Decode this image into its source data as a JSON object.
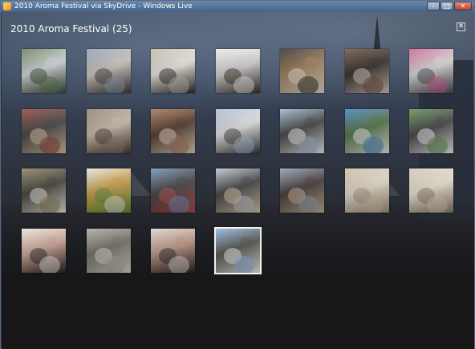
{
  "window": {
    "title": "2010 Aroma Festival via SkyDrive - Windows Live",
    "min_glyph": "–",
    "max_glyph": "□",
    "close_glyph": "✕",
    "icon": "windows-live-icon"
  },
  "album": {
    "title": "2010 Aroma Festival (25)",
    "close_glyph": "✕",
    "selected_index": 24
  },
  "thumbnails": [
    {
      "name": "photo-street-crowd",
      "colors": [
        "#5f7a4e",
        "#3c4a3a",
        "#cfd4d8"
      ]
    },
    {
      "name": "photo-crowd-trees",
      "colors": [
        "#8a9aae",
        "#3e3a36",
        "#c9c4bc"
      ]
    },
    {
      "name": "photo-barista-stall",
      "colors": [
        "#bfb4a6",
        "#2c2a2a",
        "#e9e4dc"
      ]
    },
    {
      "name": "photo-coffee-cup-snow",
      "colors": [
        "#e8e8e8",
        "#3a2e24",
        "#cfcfcf"
      ]
    },
    {
      "name": "photo-latte-art",
      "colors": [
        "#2a2420",
        "#e6dccd",
        "#9b7a55"
      ]
    },
    {
      "name": "photo-woman-sunglasses",
      "colors": [
        "#6a4a3a",
        "#d8c8b8",
        "#2a2220"
      ]
    },
    {
      "name": "photo-pink-stall",
      "colors": [
        "#c65a8a",
        "#4a4a52",
        "#d8d8d8"
      ]
    },
    {
      "name": "photo-food-stall",
      "colors": [
        "#8a3a30",
        "#d8c0a0",
        "#3a3a3a"
      ]
    },
    {
      "name": "photo-market-crowd",
      "colors": [
        "#8a7a6a",
        "#4a3a30",
        "#c8b8a8"
      ]
    },
    {
      "name": "photo-pastries",
      "colors": [
        "#a07050",
        "#e0d0c0",
        "#4a3020"
      ]
    },
    {
      "name": "photo-festival-tents",
      "colors": [
        "#a8b8d0",
        "#3a3a3a",
        "#e0e0e0"
      ]
    },
    {
      "name": "photo-white-marquee",
      "colors": [
        "#9ab0c8",
        "#f0f0f0",
        "#3a3a3a"
      ]
    },
    {
      "name": "photo-tent-trees",
      "colors": [
        "#3a7ab8",
        "#eaeaea",
        "#4a6a3a"
      ]
    },
    {
      "name": "photo-tent-crowd",
      "colors": [
        "#5a8a4a",
        "#f0f0f0",
        "#3a3a3a"
      ]
    },
    {
      "name": "photo-cake-display",
      "colors": [
        "#8a7a5a",
        "#e8e4dc",
        "#3a3a30"
      ]
    },
    {
      "name": "photo-cucumber-plate",
      "colors": [
        "#e0e4d8",
        "#5a8a3a",
        "#c89a40"
      ]
    },
    {
      "name": "photo-crowd-banners",
      "colors": [
        "#6a8ab0",
        "#b04a4a",
        "#3a3a3a"
      ]
    },
    {
      "name": "photo-camel",
      "colors": [
        "#b8c0c8",
        "#d8c8a8",
        "#3a3a3a"
      ]
    },
    {
      "name": "photo-camel-street",
      "colors": [
        "#8a9aaa",
        "#c8b090",
        "#3a3030"
      ]
    },
    {
      "name": "photo-latte-portrait",
      "colors": [
        "#c8b8a0",
        "#a89078",
        "#e0d8c8"
      ]
    },
    {
      "name": "photo-latte-portrait-2",
      "colors": [
        "#d0c4b0",
        "#8a7a68",
        "#e8e0d0"
      ]
    },
    {
      "name": "photo-two-friends",
      "colors": [
        "#e8e0d8",
        "#2a2220",
        "#c8a090"
      ]
    },
    {
      "name": "photo-latte-art-mono",
      "colors": [
        "#a8a49c",
        "#d8d4cc",
        "#6a665e"
      ]
    },
    {
      "name": "photo-two-friends-2",
      "colors": [
        "#d8d0c8",
        "#2a2220",
        "#b89080"
      ]
    },
    {
      "name": "photo-festival-overview",
      "colors": [
        "#8ab0e0",
        "#f0f0f0",
        "#4a4a40"
      ]
    }
  ]
}
